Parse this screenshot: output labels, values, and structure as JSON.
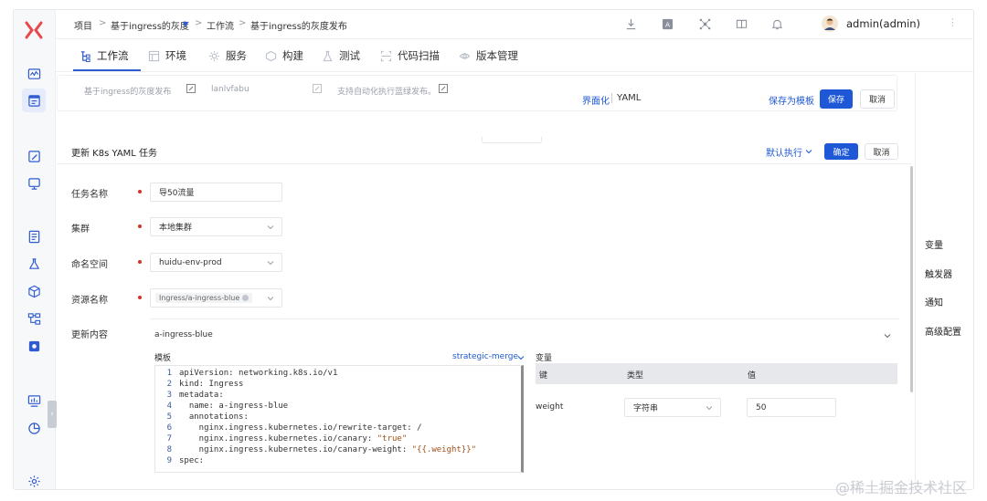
{
  "breadcrumb": {
    "project": "项目",
    "project_name": "基于ingress的灰度",
    "workflow": "工作流",
    "workflow_name": "基于ingress的灰度发布"
  },
  "user": {
    "name": "admin(admin)"
  },
  "tabs": [
    {
      "label": "工作流",
      "icon": "workflow-icon",
      "active": true
    },
    {
      "label": "环境",
      "icon": "environment-icon"
    },
    {
      "label": "服务",
      "icon": "service-icon"
    },
    {
      "label": "构建",
      "icon": "build-icon"
    },
    {
      "label": "测试",
      "icon": "test-icon"
    },
    {
      "label": "代码扫描",
      "icon": "code-scan-icon"
    },
    {
      "label": "版本管理",
      "icon": "version-icon"
    }
  ],
  "workflow_bar": {
    "display_name": "基于ingress的灰度发布",
    "key": "lanlvfabu",
    "description": "支持自动化执行蓝绿发布。",
    "mode_ui": "界面化",
    "mode_yaml": "YAML",
    "save_as_template": "保存为模板",
    "save": "保存",
    "cancel": "取消"
  },
  "task_panel": {
    "title": "更新 K8s YAML 任务",
    "default_exec": "默认执行",
    "confirm": "确定",
    "cancel": "取消"
  },
  "form": {
    "task_name_label": "任务名称",
    "task_name_value": "导50流量",
    "cluster_label": "集群",
    "cluster_value": "本地集群",
    "namespace_label": "命名空间",
    "namespace_value": "huidu-env-prod",
    "resource_label": "资源名称",
    "resource_value": "Ingress/a-ingress-blue",
    "update_label": "更新内容",
    "update_item": "a-ingress-blue"
  },
  "template": {
    "label": "模板",
    "strategy": "strategic-merge",
    "lines": [
      {
        "n": "1",
        "text": "apiVersion: networking.k8s.io/v1"
      },
      {
        "n": "2",
        "text": "kind: Ingress"
      },
      {
        "n": "3",
        "text": "metadata:"
      },
      {
        "n": "4",
        "text": "  name: a-ingress-blue"
      },
      {
        "n": "5",
        "text": "  annotations:"
      },
      {
        "n": "6",
        "text": "    nginx.ingress.kubernetes.io/rewrite-target: /"
      },
      {
        "n": "7",
        "key": "    nginx.ingress.kubernetes.io/canary: ",
        "str": "\"true\""
      },
      {
        "n": "8",
        "key": "    nginx.ingress.kubernetes.io/canary-weight: ",
        "str": "\"{{.weight}}\""
      },
      {
        "n": "9",
        "text": "spec:"
      }
    ]
  },
  "variables": {
    "label": "变量",
    "col_key": "键",
    "col_type": "类型",
    "col_value": "值",
    "row_key": "weight",
    "row_type": "字符串",
    "row_value": "50"
  },
  "side_menu": [
    "变量",
    "触发器",
    "通知",
    "高级配置"
  ],
  "watermark": "@稀土掘金技术社区",
  "colors": {
    "accent": "#1f58d6",
    "logo": "#e8474b",
    "required": "#d93026"
  }
}
